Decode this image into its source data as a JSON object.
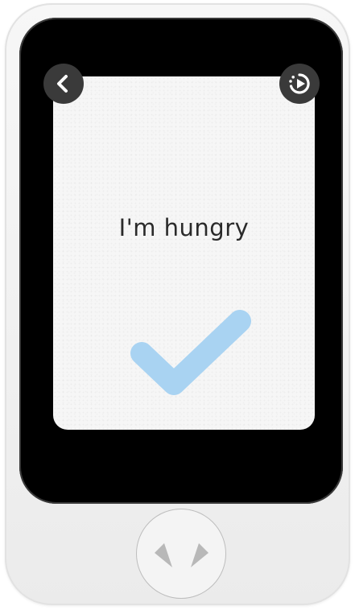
{
  "screen": {
    "phrase": "I'm hungry"
  },
  "buttons": {
    "back_icon": "chevron-left-icon",
    "replay_icon": "replay-icon",
    "home_icon": "talk-arrows-icon"
  },
  "result": {
    "icon": "checkmark-icon",
    "color": "#a9d3f2"
  },
  "colors": {
    "device_body": "#f2f2f2",
    "screen_bezel": "#000000",
    "card": "#f6f6f6",
    "button_dark": "#3a3a3a"
  }
}
